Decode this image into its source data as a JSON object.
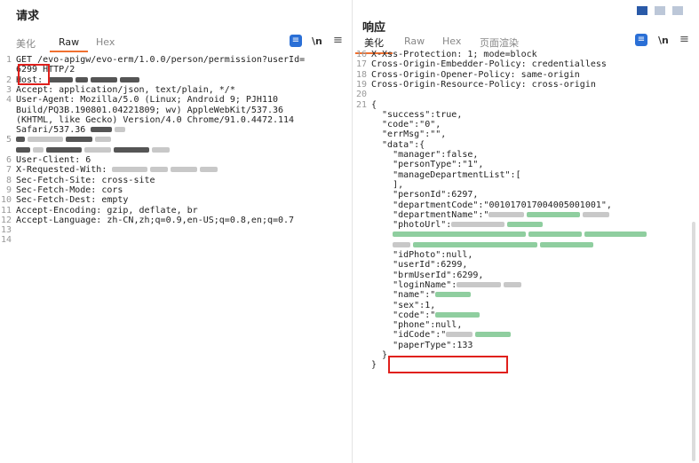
{
  "request": {
    "title": "请求",
    "tabs": [
      "美化",
      "Raw",
      "Hex"
    ],
    "active_tab": "Raw",
    "newline_toggle": "\\n",
    "lines": [
      {
        "n": "1",
        "t": "GET /evo-apigw/evo-erm/1.0.0/person/permission?userId="
      },
      {
        "n": "",
        "t": "6299 HTTP/2"
      },
      {
        "n": "2",
        "t": "Host: "
      },
      {
        "n": "3",
        "t": "Accept: application/json, text/plain, */*"
      },
      {
        "n": "4",
        "t": "User-Agent: Mozilla/5.0 (Linux; Android 9; PJH110"
      },
      {
        "n": "",
        "t": "Build/PQ3B.190801.04221809; wv) AppleWebKit/537.36"
      },
      {
        "n": "",
        "t": "(KHTML, like Gecko) Version/4.0 Chrome/91.0.4472.114"
      },
      {
        "n": "",
        "t": "Safari/537.36 "
      },
      {
        "n": "5",
        "t": ""
      },
      {
        "n": "",
        "t": ""
      },
      {
        "n": "6",
        "t": "User-Client: 6"
      },
      {
        "n": "7",
        "t": "X-Requested-With: "
      },
      {
        "n": "8",
        "t": "Sec-Fetch-Site: cross-site"
      },
      {
        "n": "9",
        "t": "Sec-Fetch-Mode: cors"
      },
      {
        "n": "10",
        "t": "Sec-Fetch-Dest: empty"
      },
      {
        "n": "11",
        "t": "Accept-Encoding: gzip, deflate, br"
      },
      {
        "n": "12",
        "t": "Accept-Language: zh-CN,zh;q=0.9,en-US;q=0.8,en;q=0.7"
      },
      {
        "n": "13",
        "t": ""
      },
      {
        "n": "14",
        "t": ""
      }
    ]
  },
  "response": {
    "title": "响应",
    "tabs": [
      "美化",
      "Raw",
      "Hex",
      "页面渲染"
    ],
    "active_tab": "美化",
    "newline_toggle": "\\n",
    "lines": [
      {
        "n": "16",
        "t": "X-Xss-Protection: 1; mode=block"
      },
      {
        "n": "17",
        "t": "Cross-Origin-Embedder-Policy: credentialless"
      },
      {
        "n": "18",
        "t": "Cross-Origin-Opener-Policy: same-origin"
      },
      {
        "n": "19",
        "t": "Cross-Origin-Resource-Policy: cross-origin"
      },
      {
        "n": "20",
        "t": ""
      },
      {
        "n": "21",
        "t": "{"
      },
      {
        "n": "",
        "t": "  \"success\":true,"
      },
      {
        "n": "",
        "t": "  \"code\":\"0\","
      },
      {
        "n": "",
        "t": "  \"errMsg\":\"\","
      },
      {
        "n": "",
        "t": "  \"data\":{"
      },
      {
        "n": "",
        "t": "    \"manager\":false,"
      },
      {
        "n": "",
        "t": "    \"personType\":\"1\","
      },
      {
        "n": "",
        "t": "    \"manageDepartmentList\":["
      },
      {
        "n": "",
        "t": "    ],"
      },
      {
        "n": "",
        "t": "    \"personId\":6297,"
      },
      {
        "n": "",
        "t": "    \"departmentCode\":\"001017017004005001001\","
      },
      {
        "n": "",
        "t": "    \"departmentName\":\""
      },
      {
        "n": "",
        "t": "    \"photoUrl\":"
      },
      {
        "n": "",
        "t": "    "
      },
      {
        "n": "",
        "t": "    "
      },
      {
        "n": "",
        "t": "    \"idPhoto\":null,"
      },
      {
        "n": "",
        "t": "    \"userId\":6299,"
      },
      {
        "n": "",
        "t": "    \"brmUserId\":6299,"
      },
      {
        "n": "",
        "t": "    \"loginName\":"
      },
      {
        "n": "",
        "t": "    \"name\":\""
      },
      {
        "n": "",
        "t": "    \"sex\":1,"
      },
      {
        "n": "",
        "t": "    \"code\":\""
      },
      {
        "n": "",
        "t": "    \"phone\":null,"
      },
      {
        "n": "",
        "t": "    \"idCode\":\""
      },
      {
        "n": "",
        "t": "    \"paperType\":133"
      },
      {
        "n": "",
        "t": "  }"
      },
      {
        "n": "",
        "t": "}"
      }
    ]
  }
}
